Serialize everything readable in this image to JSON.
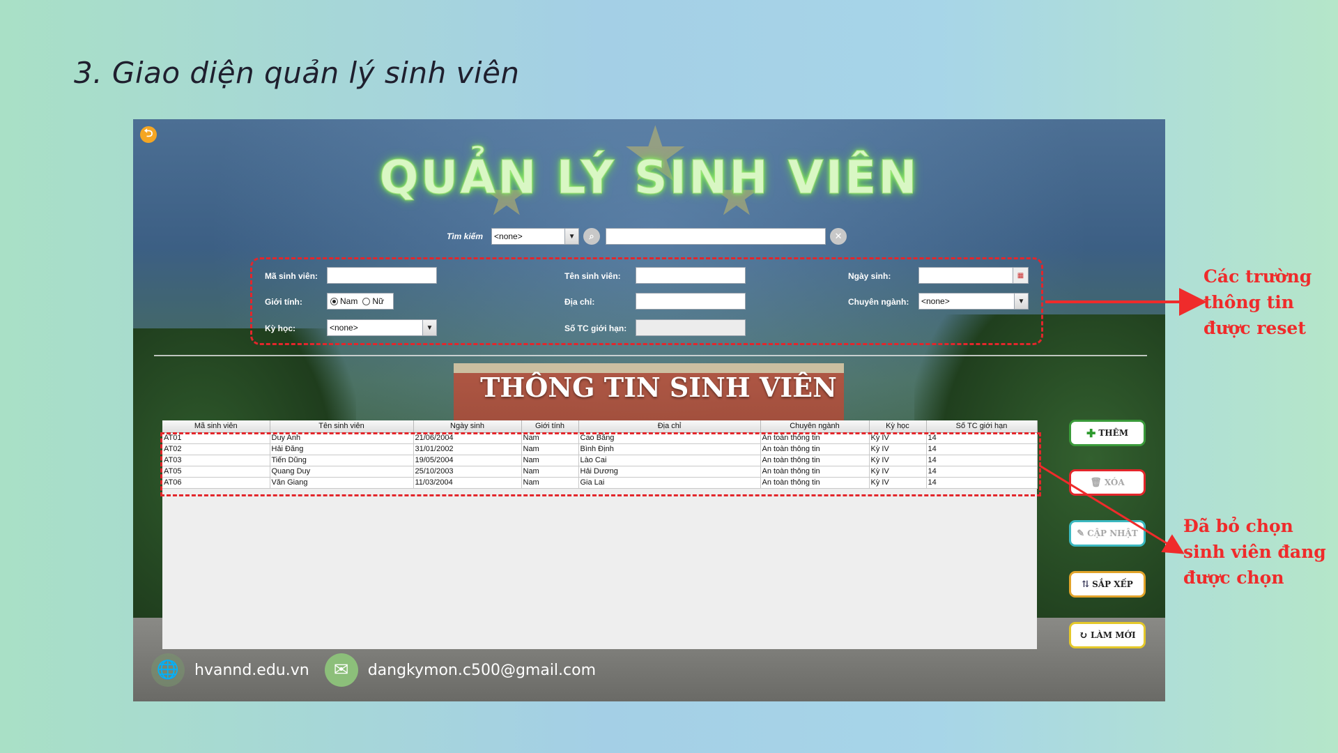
{
  "slide_title": "3. Giao diện quản lý sinh viên",
  "app": {
    "title": "QUẢN LÝ SINH VIÊN",
    "search": {
      "label": "Tìm kiếm",
      "field_value": "<none>",
      "keyword": ""
    },
    "form": {
      "ma_sv_label": "Mã sinh viên:",
      "ten_sv_label": "Tên sinh viên:",
      "ngay_sinh_label": "Ngày sinh:",
      "gioi_tinh_label": "Giới tính:",
      "gioi_tinh_nam": "Nam",
      "gioi_tinh_nu": "Nữ",
      "dia_chi_label": "Địa chỉ:",
      "chuyen_nganh_label": "Chuyên ngành:",
      "chuyen_nganh_value": "<none>",
      "ky_hoc_label": "Kỳ học:",
      "ky_hoc_value": "<none>",
      "so_tc_label": "Số TC giới hạn:"
    },
    "section_title": "THÔNG TIN SINH VIÊN",
    "table": {
      "headers": [
        "Mã sinh viên",
        "Tên sinh viên",
        "Ngày sinh",
        "Giới tính",
        "Địa chỉ",
        "Chuyên ngành",
        "Kỳ học",
        "Số TC giới hạn"
      ],
      "rows": [
        [
          "AT01",
          "Duy Anh",
          "21/06/2004",
          "Nam",
          "Cao Bằng",
          "An toàn thông tin",
          "Kỳ IV",
          "14"
        ],
        [
          "AT02",
          "Hải Đăng",
          "31/01/2002",
          "Nam",
          "Bình Định",
          "An toàn thông tin",
          "Kỳ IV",
          "14"
        ],
        [
          "AT03",
          "Tiến Dũng",
          "19/05/2004",
          "Nam",
          "Lào Cai",
          "An toàn thông tin",
          "Kỳ IV",
          "14"
        ],
        [
          "AT05",
          "Quang Duy",
          "25/10/2003",
          "Nam",
          "Hải Dương",
          "An toàn thông tin",
          "Kỳ IV",
          "14"
        ],
        [
          "AT06",
          "Văn Giang",
          "11/03/2004",
          "Nam",
          "Gia Lai",
          "An toàn thông tin",
          "Kỳ IV",
          "14"
        ]
      ]
    },
    "buttons": {
      "them": "THÊM",
      "xoa": "XÓA",
      "cap_nhat": "CẬP NHẬT",
      "sap_xep": "SẮP XẾP",
      "lam_moi": "LÀM MỚI"
    },
    "footer": {
      "website": "hvannd.edu.vn",
      "email": "dangkymon.c500@gmail.com"
    },
    "colors": {
      "annotation": "#ef2b2b",
      "title_glow": "#9dff72"
    }
  },
  "annotations": {
    "reset_lines": [
      "Các trường",
      "thông tin",
      "được reset"
    ],
    "deselect_lines": [
      "Đã bỏ chọn",
      "sinh viên đang",
      "được chọn"
    ]
  }
}
